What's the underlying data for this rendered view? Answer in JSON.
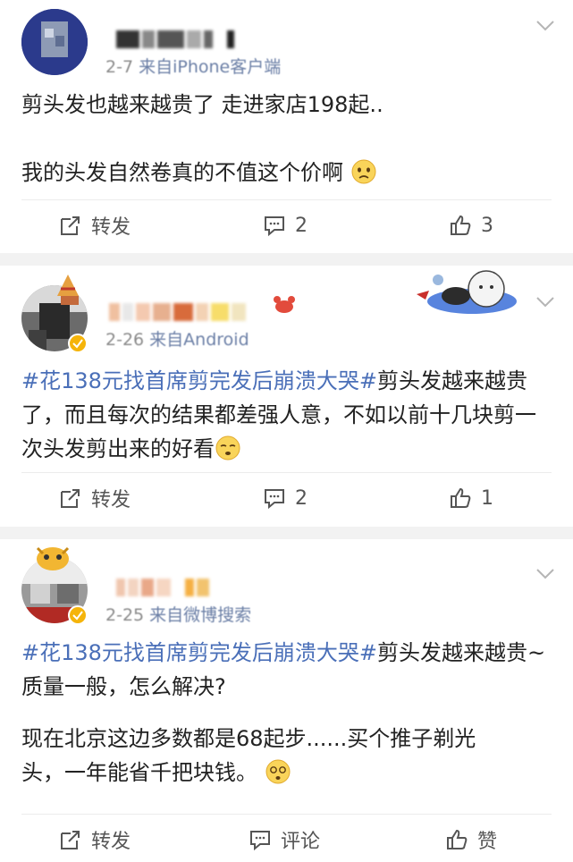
{
  "posts": [
    {
      "meta_prefix": "2-7",
      "meta_source": "来自iPhone客户端",
      "text_lines": [
        "剪头发也越来越贵了 走进家店198起..",
        "",
        "我的头发自然卷真的不值这个价啊"
      ],
      "repost_label": "转发",
      "comment_count": "2",
      "like_count": "3"
    },
    {
      "meta_prefix": "2-26",
      "meta_source": "来自Android",
      "topic": "#花138元找首席剪完发后崩溃大哭#",
      "text_after_topic": "剪头发越来越贵了，而且每次的结果都差强人意，不如以前十几块剪一次头发剪出来的好看",
      "repost_label": "转发",
      "comment_count": "2",
      "like_count": "1"
    },
    {
      "meta_prefix": "2-25",
      "meta_source": "来自微博搜索",
      "topic": "#花138元找首席剪完发后崩溃大哭#",
      "text_after_topic": "剪头发越来越贵~质量一般，怎么解决?",
      "text_para2_line1": "现在北京这边多数都是68起步......买个推子剃光",
      "text_para2_line2": "头，一年能省千把块钱。",
      "repost_label": "转发",
      "comment_label": "评论",
      "like_label": "赞"
    }
  ],
  "icons": {
    "caret": "chevron-down-icon",
    "repost": "share-icon",
    "comment": "comment-icon",
    "like": "thumbs-up-icon",
    "emoji_sad": "sad-face-emoji-icon",
    "emoji_sleepy": "sleepy-face-emoji-icon",
    "emoji_dizzy": "dizzy-face-emoji-icon"
  },
  "colors": {
    "topic": "#4a6fb8",
    "separator": "#f2f2f2",
    "meta": "#8a8a8a",
    "text": "#222222"
  }
}
